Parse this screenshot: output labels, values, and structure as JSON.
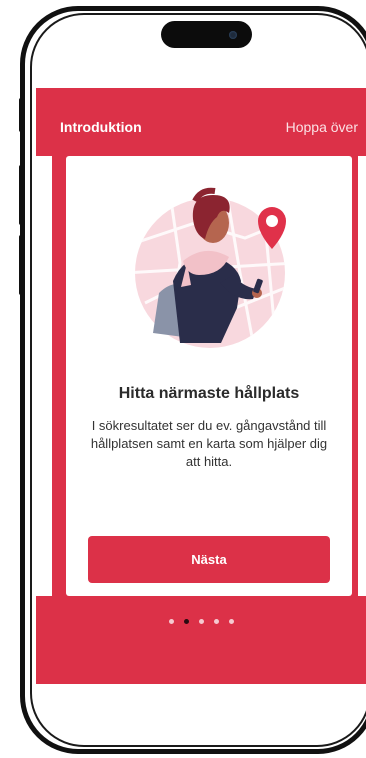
{
  "header": {
    "title": "Introduktion",
    "skip_label": "Hoppa över"
  },
  "card": {
    "title": "Hitta närmaste hållplats",
    "body": "I sökresultatet ser du ev. gångavstånd till hållplatsen samt en karta som hjälper dig att hitta.",
    "next_label": "Nästa",
    "illustration_icon": "person-with-phone-location-pin"
  },
  "pager": {
    "total": 5,
    "active_index": 1
  },
  "colors": {
    "brand_red": "#dc3148",
    "pin_red": "#e0314a",
    "card_bg": "#ffffff"
  }
}
